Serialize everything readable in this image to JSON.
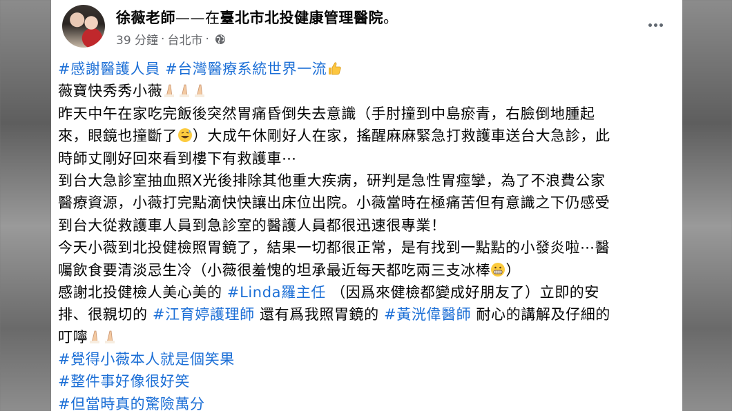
{
  "post": {
    "author": "徐薇老師",
    "separator": "——在",
    "location": "臺北市北投健康管理醫院",
    "period": "。",
    "time": "39 分鐘",
    "dot": "·",
    "city": "台北市",
    "dot2": "·"
  },
  "content": {
    "line1_tag1": "#感謝醫護人員",
    "line1_tag2": "#台灣醫療系統世界一流",
    "line2": "薇寶快秀秀小薇",
    "line3": "昨天中午在家吃完飯後突然胃痛昏倒失去意識（手肘撞到中島瘀青，右臉倒地腫起",
    "line4a": "來，眼鏡也撞斷了",
    "line4b": "）大成午休剛好人在家，搖醒麻麻緊急打救護車送台大急診，此",
    "line5": "時師丈剛好回來看到樓下有救護車⋯",
    "line6": "到台大急診室抽血照X光後排除其他重大疾病，研判是急性胃痙攣，為了不浪費公家",
    "line7": "醫療資源，小薇打完點滴快快讓出床位出院。小薇當時在極痛苦但有意識之下仍感受",
    "line8": "到台大從救護車人員到急診室的醫護人員都很迅速很專業！",
    "line9": "今天小薇到北投健檢照胃鏡了，結果一切都很正常，是有找到一點點的小發炎啦⋯醫",
    "line10": "囑飲食要清淡忌生冷（小薇很羞愧的坦承最近每天都吃兩三支冰棒",
    "line10_end": "）",
    "line11a": "感謝北投健檢人美心美的 ",
    "line11_tag": "#Linda羅主任",
    "line11b": " （因爲來健檢都變成好朋友了）立即的安",
    "line12a": "排、很親切的 ",
    "line12_tag1": "#江育婷護理師",
    "line12b": " 還有爲我照胃鏡的 ",
    "line12_tag2": "#黃洸偉醫師",
    "line12c": " 耐心的講解及仔細的",
    "line13": "叮嚀",
    "line14_tag": "#覺得小薇本人就是個笑果",
    "line15_tag": "#整件事好像很好笑",
    "line16_tag": "#但當時真的驚險萬分"
  },
  "icons": {
    "avatar": "profile-photo",
    "globe": "globe-icon",
    "more": "more-options-icon",
    "thumbs": "thumbs-up-emoji",
    "pray": "folded-hands-emoji",
    "sweat": "grinning-sweat-emoji",
    "grimace": "grimacing-emoji"
  },
  "colors": {
    "hashtag": "#1c6fd6",
    "meta": "#65676b",
    "text": "#050505"
  }
}
